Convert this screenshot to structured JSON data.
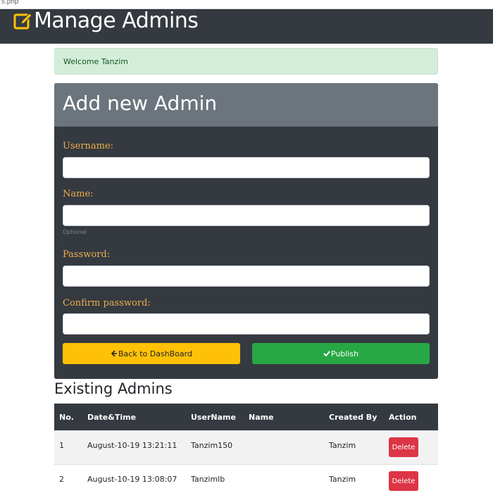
{
  "browser": {
    "url_fragment": "s.php"
  },
  "header": {
    "title": "Manage Admins",
    "icon": "edit-icon"
  },
  "alert": {
    "message": "Welcome Tanzim"
  },
  "form": {
    "title": "Add new Admin",
    "username_label": "Username:",
    "username_value": "",
    "name_label": "Name:",
    "name_value": "",
    "name_hint": "Optional",
    "password_label": "Password:",
    "password_value": "",
    "confirm_label": "Confirm password:",
    "confirm_value": "",
    "back_button": "Back to DashBoard",
    "back_icon": "arrow-left-icon",
    "publish_button": "Publish",
    "publish_icon": "check-icon"
  },
  "admins": {
    "title": "Existing Admins",
    "columns": [
      "No.",
      "Date&Time",
      "UserName",
      "Name",
      "Created By",
      "Action"
    ],
    "rows": [
      {
        "no": "1",
        "datetime": "August-10-19 13:21:11",
        "username": "Tanzim150",
        "name": "",
        "created_by": "Tanzim",
        "action": "Delete"
      },
      {
        "no": "2",
        "datetime": "August-10-19 13:08:07",
        "username": "Tanzimlb",
        "name": "",
        "created_by": "Tanzim",
        "action": "Delete"
      }
    ]
  },
  "colors": {
    "header_bg": "#343a40",
    "card_header_bg": "#6c757d",
    "label_color": "#f0ad4e",
    "warning": "#ffc107",
    "success": "#28a745",
    "danger": "#dc3545",
    "alert_bg": "#d4edda"
  }
}
